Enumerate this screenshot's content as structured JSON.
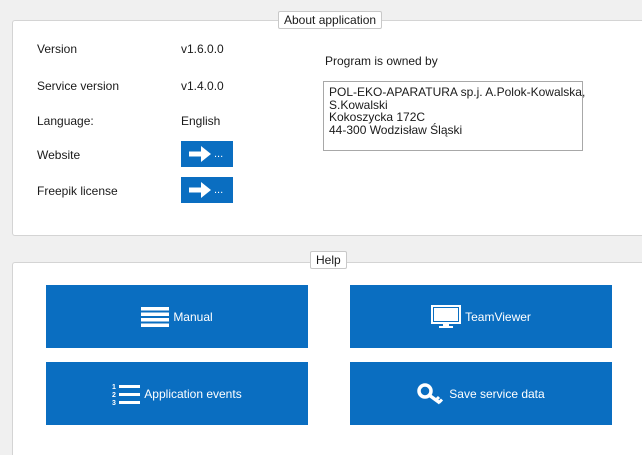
{
  "about": {
    "title": "About application",
    "rows": [
      {
        "label": "Version",
        "value": "v1.6.0.0"
      },
      {
        "label": "Service version",
        "value": "v1.4.0.0"
      },
      {
        "label": "Language:",
        "value": "English"
      }
    ],
    "website_label": "Website",
    "freepik_label": "Freepik license",
    "link_button_text": "...",
    "owner_heading": "Program is owned by",
    "owner_lines": [
      "POL-EKO-APARATURA sp.j. A.Polok-Kowalska,",
      "S.Kowalski",
      "Kokoszycka 172C",
      "44-300 Wodzisław Śląski"
    ]
  },
  "help": {
    "title": "Help",
    "buttons": {
      "manual": "Manual",
      "teamviewer": "TeamViewer",
      "events": "Application events",
      "service_data": "Save service data"
    }
  },
  "colors": {
    "accent": "#0a6ec1",
    "panel_bg": "#ffffff",
    "window_bg": "#f0f0f0"
  },
  "icons": {
    "link": "arrow-right-icon",
    "manual": "menu-lines-icon",
    "teamviewer": "monitor-icon",
    "events": "numbered-list-icon",
    "service_data": "key-icon"
  }
}
